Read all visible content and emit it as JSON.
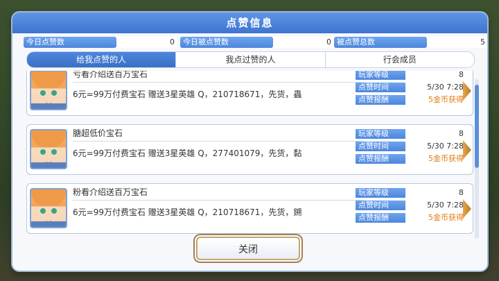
{
  "dialog": {
    "title": "点赞信息"
  },
  "stats": [
    {
      "label": "今日点赞数",
      "value": "0"
    },
    {
      "label": "今日被点赞数",
      "value": "0"
    },
    {
      "label": "被点赞总数",
      "value": "5"
    }
  ],
  "tabs": [
    {
      "label": "给我点赞的人",
      "active": true
    },
    {
      "label": "我点过赞的人",
      "active": false
    },
    {
      "label": "行会成员",
      "active": false
    }
  ],
  "info_labels": {
    "level": "玩家等级",
    "time": "点赞时间",
    "reward": "点赞报酬"
  },
  "entries": [
    {
      "name": "亏看介绍送百万宝石",
      "message": "6元=99万付费宝石 赠送3星英雄 Q，210718671，先货，蟲",
      "level": "8",
      "time": "5/30 7:28",
      "reward": "5金币获得"
    },
    {
      "name": "膅超低价宝石",
      "message": "6元=99万付费宝石 赠送3星英雄 Q，277401079，先货，黏",
      "level": "8",
      "time": "5/30 7:28",
      "reward": "5金币获得"
    },
    {
      "name": "粉看介绍送百万宝石",
      "message": "6元=99万付费宝石 赠送3星英雄 Q，210718671，先货，鎙",
      "level": "8",
      "time": "5/30 7:28",
      "reward": "5金币获得"
    }
  ],
  "buttons": {
    "close": "关闭"
  },
  "colors": {
    "accent_blue": "#4d86dc",
    "reward_gold": "#e07c10"
  }
}
